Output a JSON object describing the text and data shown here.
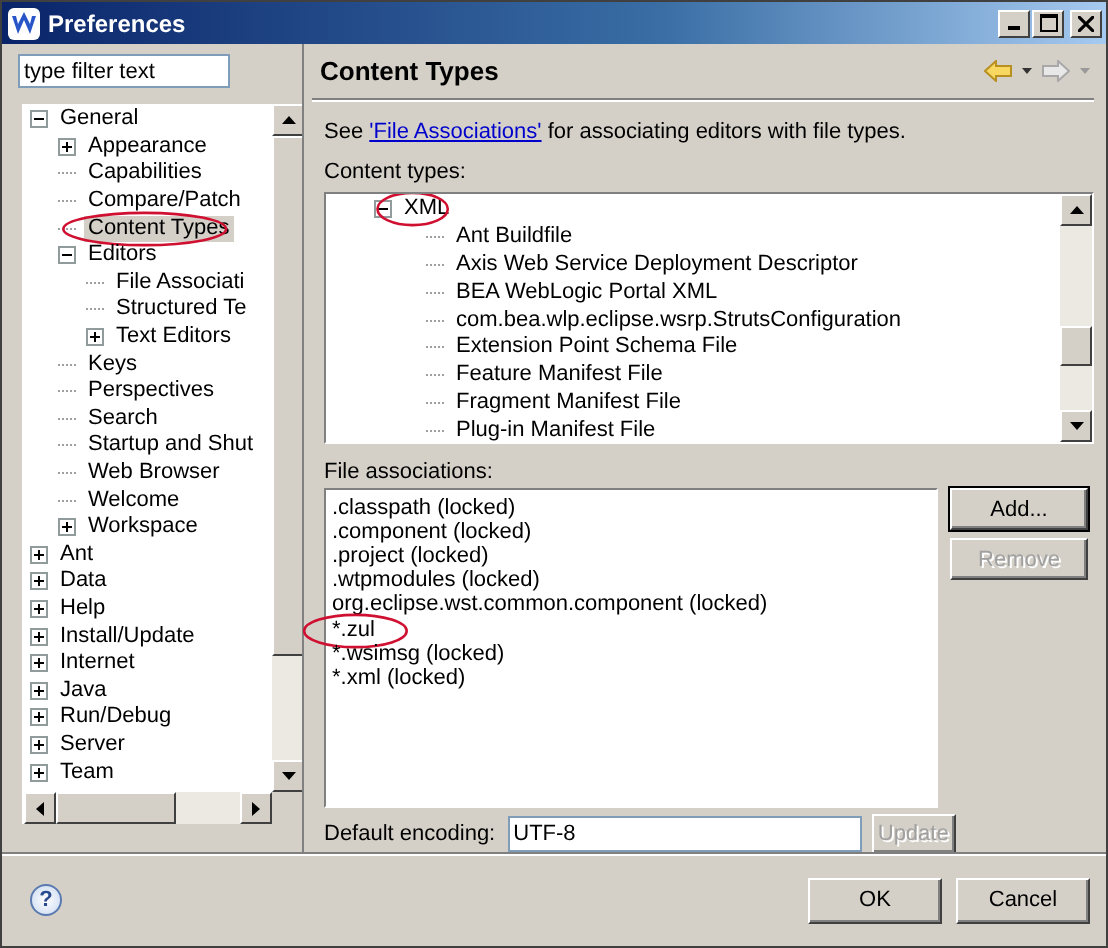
{
  "window": {
    "title": "Preferences"
  },
  "filter": {
    "placeholder": "type filter text"
  },
  "nav": {
    "items": [
      {
        "label": "General",
        "expanded": true,
        "selected": false,
        "circled": false,
        "children": [
          {
            "label": "Appearance",
            "expanded": false,
            "selected": false,
            "circled": false
          },
          {
            "label": "Capabilities",
            "selected": false,
            "circled": false
          },
          {
            "label": "Compare/Patch",
            "selected": false,
            "circled": false
          },
          {
            "label": "Content Types",
            "selected": true,
            "circled": true
          },
          {
            "label": "Editors",
            "expanded": true,
            "selected": false,
            "circled": false,
            "children": [
              {
                "label": "File Associati",
                "selected": false,
                "circled": false
              },
              {
                "label": "Structured Te",
                "selected": false,
                "circled": false
              },
              {
                "label": "Text Editors",
                "expanded": false,
                "selected": false,
                "circled": false
              }
            ]
          },
          {
            "label": "Keys",
            "selected": false,
            "circled": false
          },
          {
            "label": "Perspectives",
            "selected": false,
            "circled": false
          },
          {
            "label": "Search",
            "selected": false,
            "circled": false
          },
          {
            "label": "Startup and Shut",
            "selected": false,
            "circled": false
          },
          {
            "label": "Web Browser",
            "selected": false,
            "circled": false
          },
          {
            "label": "Welcome",
            "selected": false,
            "circled": false
          },
          {
            "label": "Workspace",
            "expanded": false,
            "selected": false,
            "circled": false
          }
        ]
      },
      {
        "label": "Ant",
        "expanded": false,
        "selected": false,
        "circled": false
      },
      {
        "label": "Data",
        "expanded": false,
        "selected": false,
        "circled": false
      },
      {
        "label": "Help",
        "expanded": false,
        "selected": false,
        "circled": false
      },
      {
        "label": "Install/Update",
        "expanded": false,
        "selected": false,
        "circled": false
      },
      {
        "label": "Internet",
        "expanded": false,
        "selected": false,
        "circled": false
      },
      {
        "label": "Java",
        "expanded": false,
        "selected": false,
        "circled": false
      },
      {
        "label": "Run/Debug",
        "expanded": false,
        "selected": false,
        "circled": false
      },
      {
        "label": "Server",
        "expanded": false,
        "selected": false,
        "circled": false
      },
      {
        "label": "Team",
        "expanded": false,
        "selected": false,
        "circled": false
      }
    ]
  },
  "page": {
    "title": "Content Types",
    "intro_before": "See ",
    "intro_link": "'File Associations'",
    "intro_after": " for associating editors with file types.",
    "content_types": {
      "label": "Content types:",
      "items": [
        {
          "label": "XML",
          "expanded": true,
          "selected": false,
          "circled": true,
          "children": [
            {
              "label": "Ant Buildfile",
              "selected": false,
              "circled": false
            },
            {
              "label": "Axis Web Service Deployment Descriptor",
              "selected": false,
              "circled": false
            },
            {
              "label": "BEA WebLogic Portal XML",
              "selected": false,
              "circled": false
            },
            {
              "label": "com.bea.wlp.eclipse.wsrp.StrutsConfiguration",
              "selected": false,
              "circled": false
            },
            {
              "label": "Extension Point Schema File",
              "selected": false,
              "circled": false
            },
            {
              "label": "Feature Manifest File",
              "selected": false,
              "circled": false
            },
            {
              "label": "Fragment Manifest File",
              "selected": false,
              "circled": false
            },
            {
              "label": "Plug-in Manifest File",
              "selected": false,
              "circled": false
            }
          ]
        }
      ]
    },
    "file_associations": {
      "label": "File associations:",
      "items": [
        {
          "label": ".classpath (locked)",
          "selected": false,
          "circled": false
        },
        {
          "label": ".component (locked)",
          "selected": false,
          "circled": false
        },
        {
          "label": ".project (locked)",
          "selected": false,
          "circled": false
        },
        {
          "label": ".wtpmodules (locked)",
          "selected": false,
          "circled": false
        },
        {
          "label": "org.eclipse.wst.common.component (locked)",
          "selected": false,
          "circled": false
        },
        {
          "label": "*.zul",
          "selected": false,
          "circled": true
        },
        {
          "label": "*.wsimsg (locked)",
          "selected": false,
          "circled": false
        },
        {
          "label": "*.xml (locked)",
          "selected": false,
          "circled": false
        }
      ],
      "buttons": [
        {
          "label": "Add...",
          "disabled": false,
          "default": true
        },
        {
          "label": "Remove",
          "disabled": true,
          "default": false
        }
      ]
    },
    "encoding": {
      "label": "Default encoding:",
      "value": "UTF-8",
      "button": {
        "label": "Update",
        "disabled": true
      }
    }
  },
  "footer": {
    "help": "?",
    "buttons": [
      {
        "label": "OK",
        "disabled": false
      },
      {
        "label": "Cancel",
        "disabled": false
      }
    ]
  }
}
